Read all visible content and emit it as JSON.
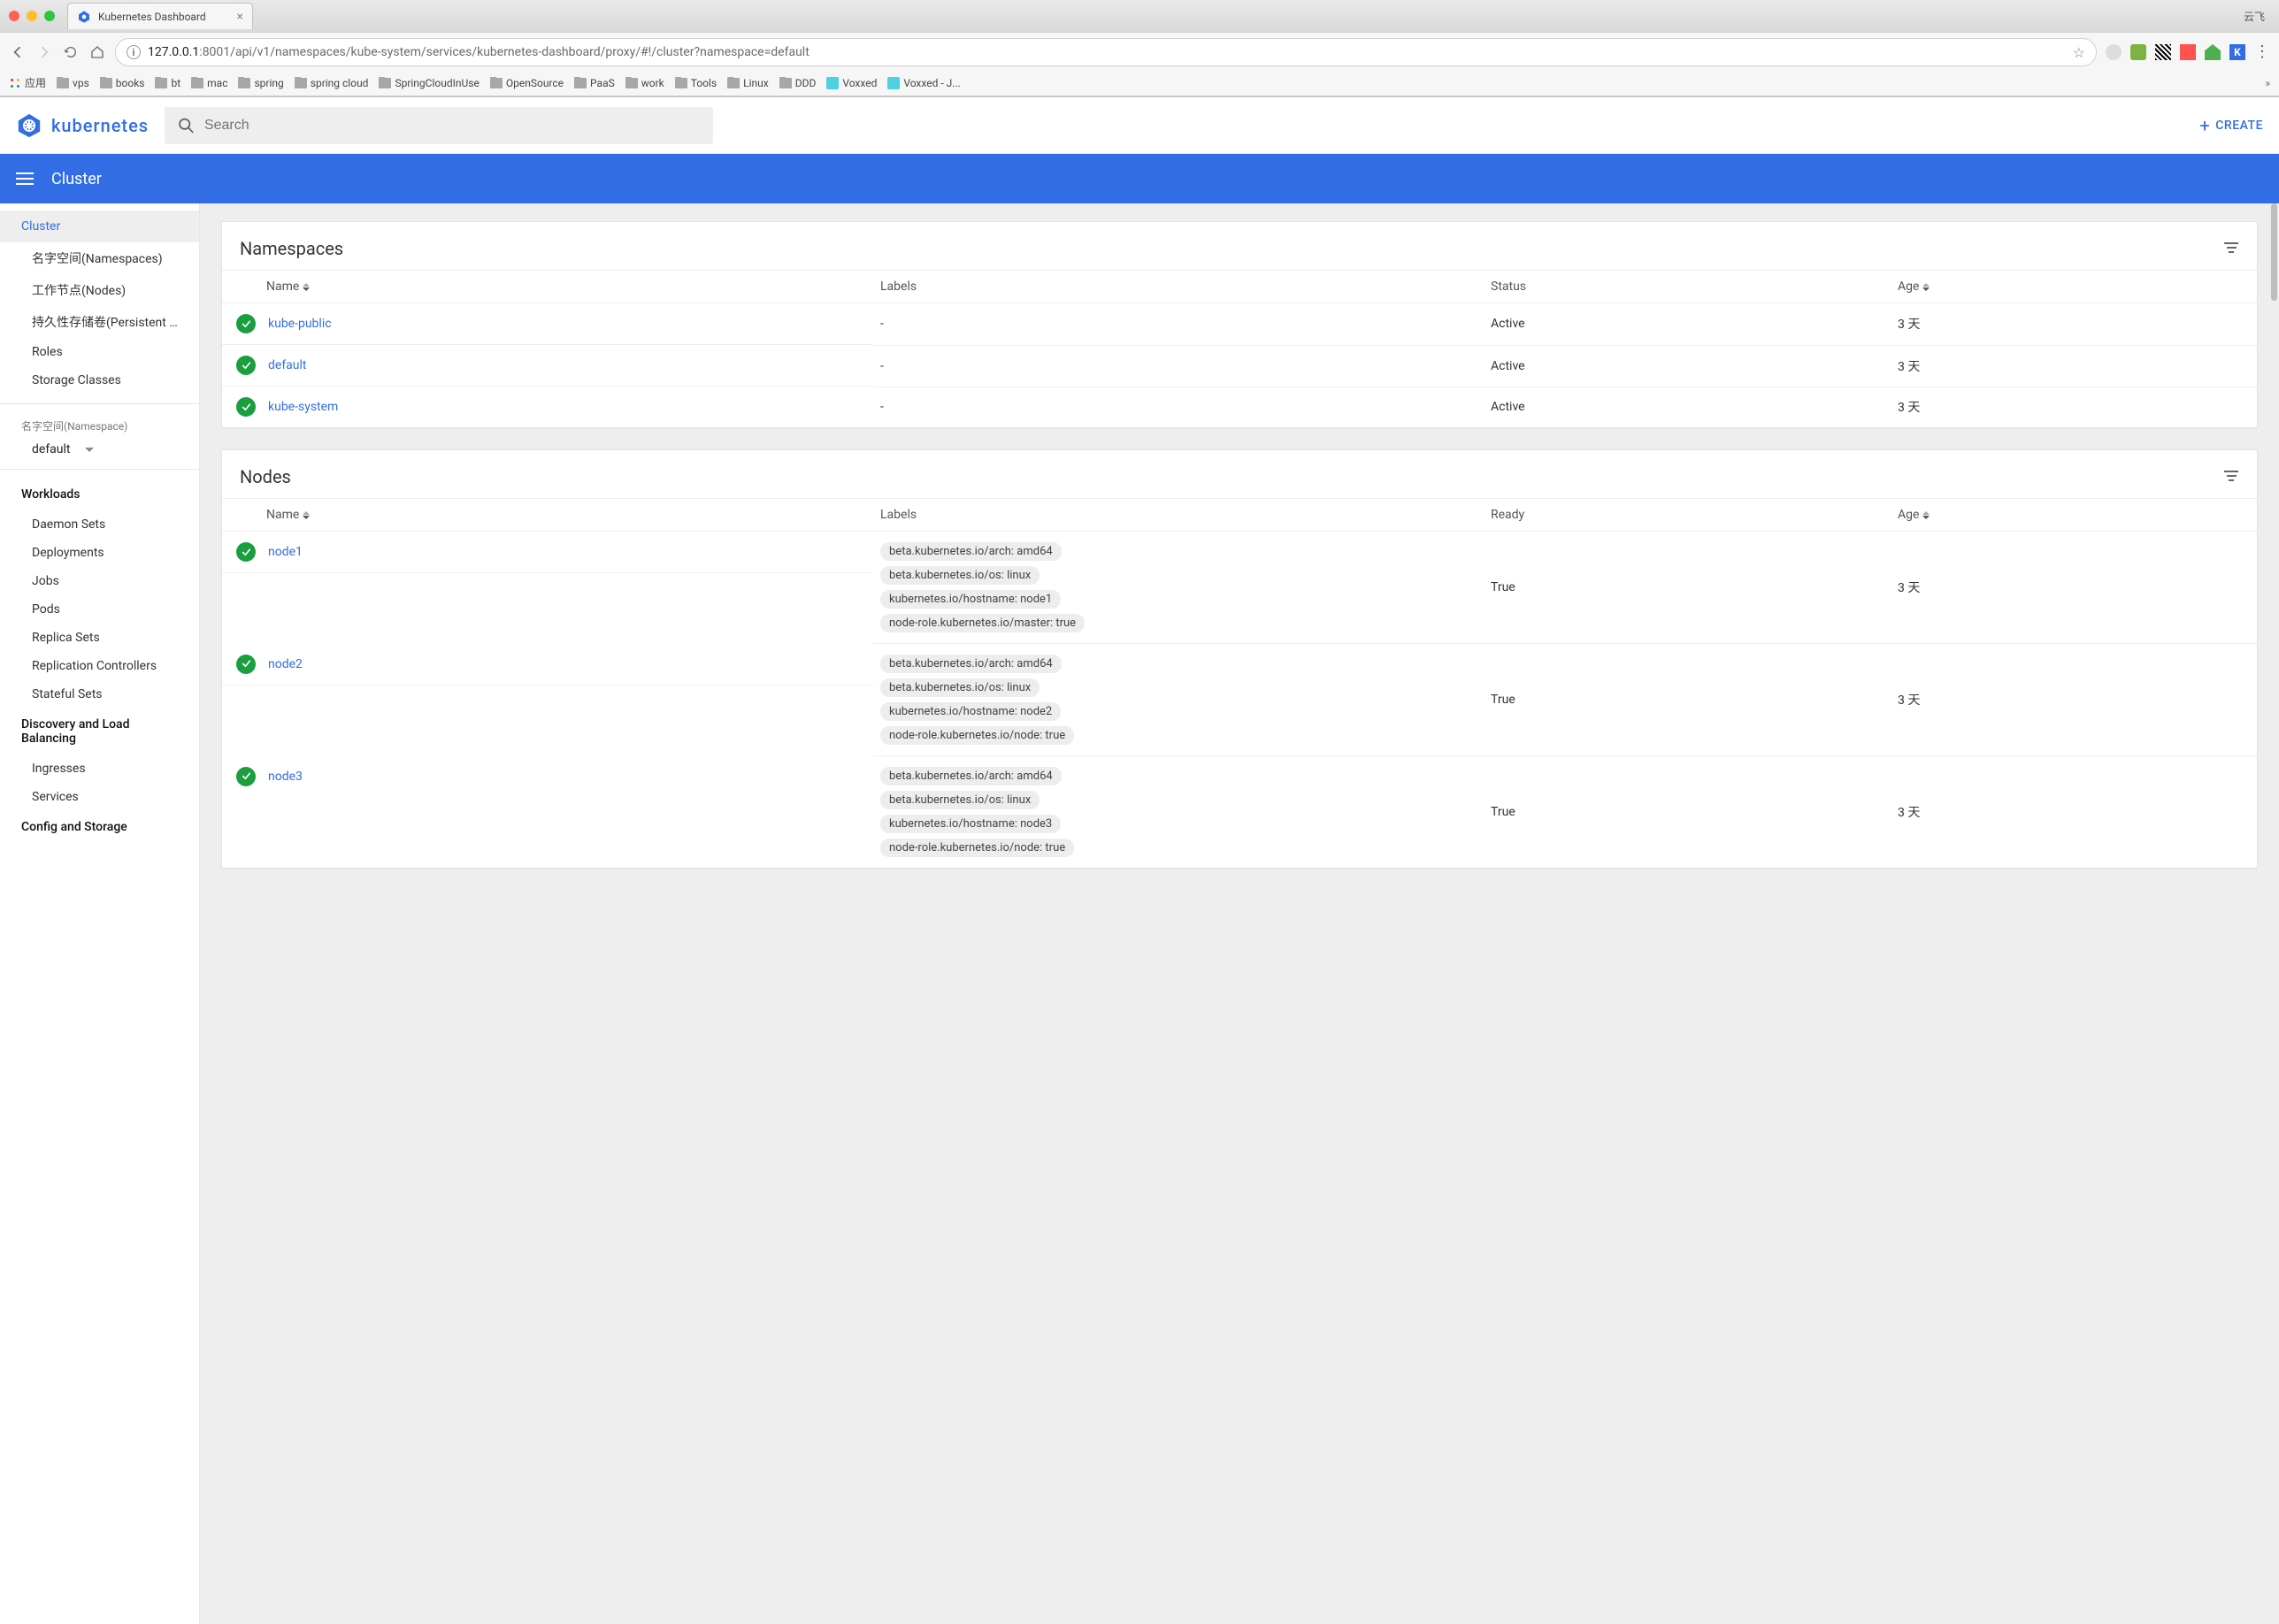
{
  "browser": {
    "tab_title": "Kubernetes Dashboard",
    "user_tag": "云飞",
    "url_host": "127.0.0.1",
    "url_port": ":8001",
    "url_path": "/api/v1/namespaces/kube-system/services/kubernetes-dashboard/proxy/#!/cluster?namespace=default",
    "bookmarks_label": "应用",
    "bookmarks": [
      "vps",
      "books",
      "bt",
      "mac",
      "spring",
      "spring cloud",
      "SpringCloudInUse",
      "OpenSource",
      "PaaS",
      "work",
      "Tools",
      "Linux",
      "DDD",
      "Voxxed",
      "Voxxed - J..."
    ]
  },
  "header": {
    "brand": "kubernetes",
    "search_placeholder": "Search",
    "create_label": "CREATE"
  },
  "bluebar": {
    "title": "Cluster"
  },
  "sidebar": {
    "cluster_label": "Cluster",
    "cluster_children": [
      "名字空间(Namespaces)",
      "工作节点(Nodes)",
      "持久性存储卷(Persistent Volumes)",
      "Roles",
      "Storage Classes"
    ],
    "ns_section_label": "名字空间(Namespace)",
    "ns_selected": "default",
    "workloads_label": "Workloads",
    "workloads_children": [
      "Daemon Sets",
      "Deployments",
      "Jobs",
      "Pods",
      "Replica Sets",
      "Replication Controllers",
      "Stateful Sets"
    ],
    "discovery_label": "Discovery and Load Balancing",
    "discovery_children": [
      "Ingresses",
      "Services"
    ],
    "config_label": "Config and Storage"
  },
  "namespaces_card": {
    "title": "Namespaces",
    "columns": {
      "name": "Name",
      "labels": "Labels",
      "status": "Status",
      "age": "Age"
    },
    "rows": [
      {
        "name": "kube-public",
        "labels": "-",
        "status": "Active",
        "age": "3 天"
      },
      {
        "name": "default",
        "labels": "-",
        "status": "Active",
        "age": "3 天"
      },
      {
        "name": "kube-system",
        "labels": "-",
        "status": "Active",
        "age": "3 天"
      }
    ]
  },
  "nodes_card": {
    "title": "Nodes",
    "columns": {
      "name": "Name",
      "labels": "Labels",
      "ready": "Ready",
      "age": "Age"
    },
    "rows": [
      {
        "name": "node1",
        "labels": [
          "beta.kubernetes.io/arch: amd64",
          "beta.kubernetes.io/os: linux",
          "kubernetes.io/hostname: node1",
          "node-role.kubernetes.io/master: true"
        ],
        "ready": "True",
        "age": "3 天"
      },
      {
        "name": "node2",
        "labels": [
          "beta.kubernetes.io/arch: amd64",
          "beta.kubernetes.io/os: linux",
          "kubernetes.io/hostname: node2",
          "node-role.kubernetes.io/node: true"
        ],
        "ready": "True",
        "age": "3 天"
      },
      {
        "name": "node3",
        "labels": [
          "beta.kubernetes.io/arch: amd64",
          "beta.kubernetes.io/os: linux",
          "kubernetes.io/hostname: node3",
          "node-role.kubernetes.io/node: true"
        ],
        "ready": "True",
        "age": "3 天"
      }
    ]
  }
}
